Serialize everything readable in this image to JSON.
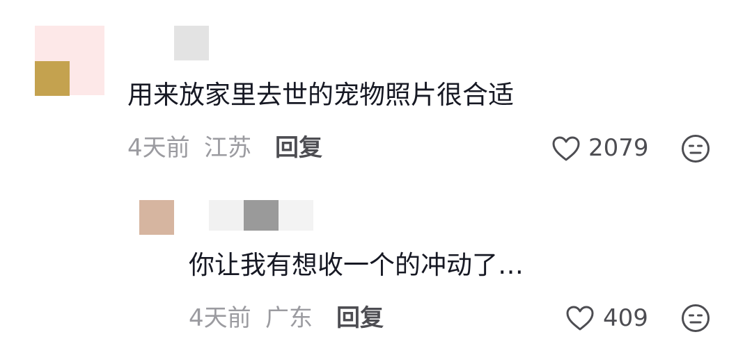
{
  "comments": [
    {
      "text": "用来放家里去世的宠物照片很合适",
      "time": "4天前",
      "location": "江苏",
      "reply_label": "回复",
      "likes": "2079"
    },
    {
      "text": "你让我有想收一个的冲动了…",
      "time": "4天前",
      "location": "广东",
      "reply_label": "回复",
      "likes": "409"
    }
  ],
  "colors": {
    "text": "#161823",
    "meta": "#9b9ba0",
    "action": "#4d4d52"
  },
  "icons": [
    "heart-icon",
    "dislike-face-icon"
  ]
}
